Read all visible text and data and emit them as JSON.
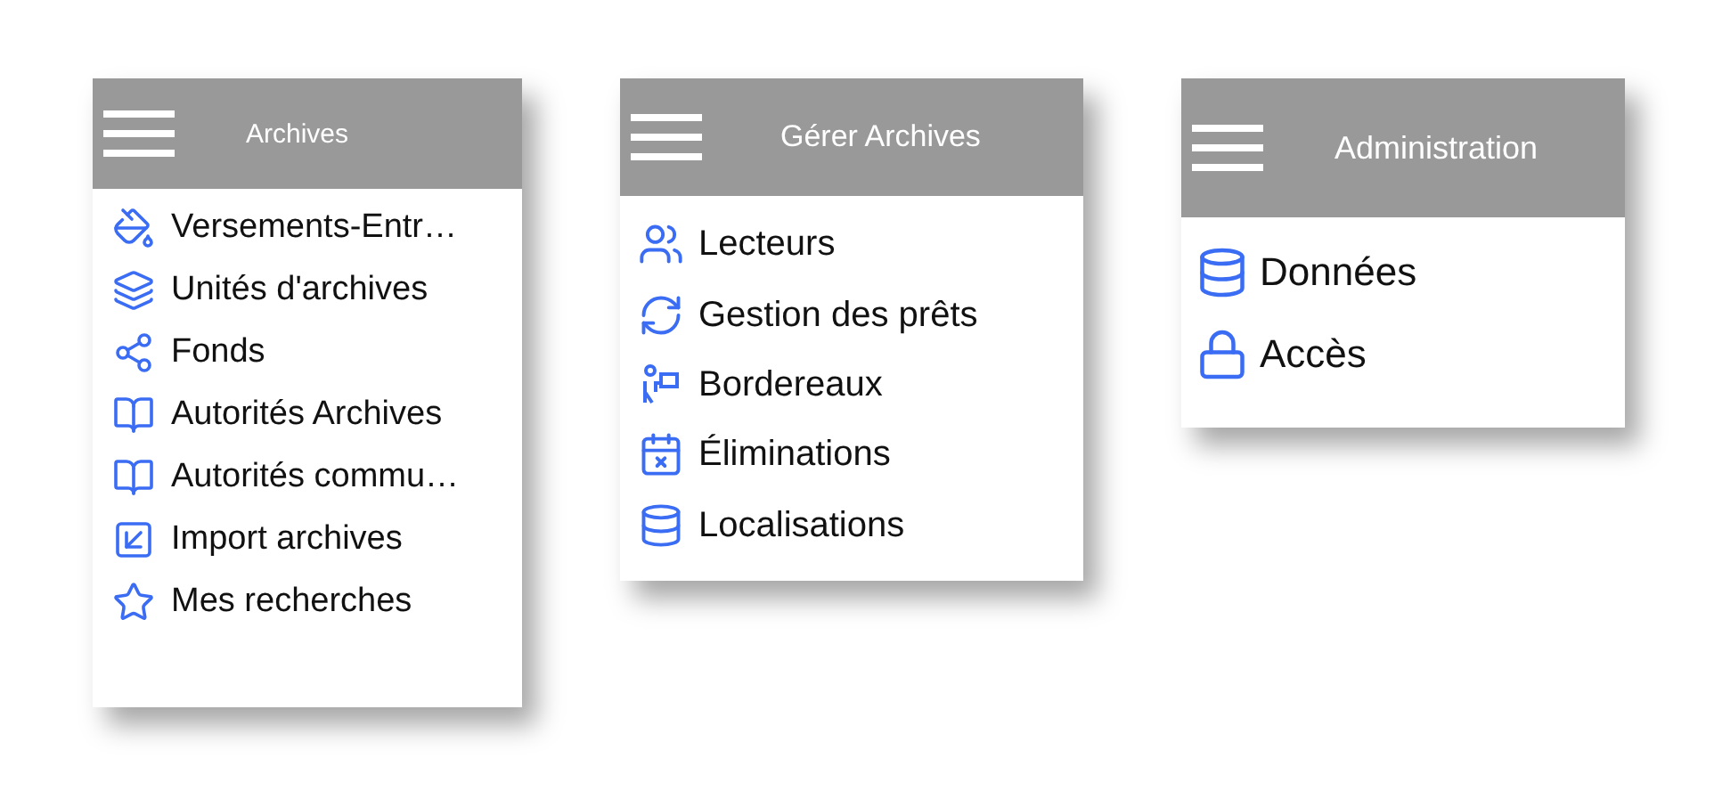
{
  "menus": [
    {
      "title": "Archives",
      "items": [
        {
          "label": "Versements-Entr…"
        },
        {
          "label": "Unités d'archives"
        },
        {
          "label": "Fonds"
        },
        {
          "label": "Autorités Archives"
        },
        {
          "label": "Autorités commu…"
        },
        {
          "label": "Import archives"
        },
        {
          "label": "Mes recherches"
        }
      ]
    },
    {
      "title": "Gérer Archives",
      "items": [
        {
          "label": "Lecteurs"
        },
        {
          "label": "Gestion des prêts"
        },
        {
          "label": "Bordereaux"
        },
        {
          "label": "Éliminations"
        },
        {
          "label": "Localisations"
        }
      ]
    },
    {
      "title": "Administration",
      "items": [
        {
          "label": "Données"
        },
        {
          "label": "Accès"
        }
      ]
    }
  ]
}
